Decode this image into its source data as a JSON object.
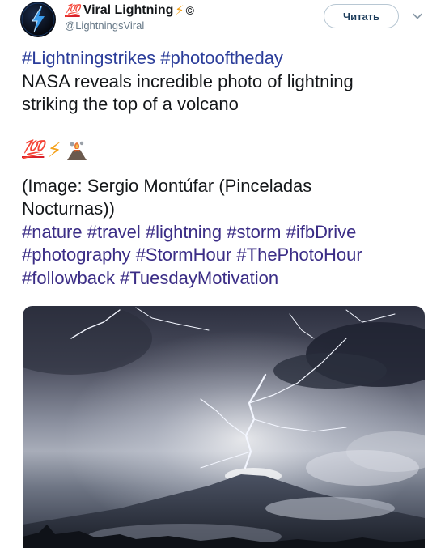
{
  "account": {
    "badge_emoji": "💯",
    "display_name": "Viral Lightning",
    "bolt_emoji": "⚡",
    "copyright": "©",
    "handle": "@LightningsViral",
    "avatar": "lightning-avatar"
  },
  "follow_button": {
    "label": "Читать"
  },
  "more_menu": {
    "icon": "chevron-down-icon"
  },
  "tweet": {
    "hashtags_top": [
      "#Lightningstrikes",
      "#photooftheday"
    ],
    "headline_lines": [
      "NASA reveals incredible photo of lightning",
      "striking the top of a volcano"
    ],
    "emojis": {
      "hundred": "💯",
      "bolt": "⚡",
      "volcano": "🌋"
    },
    "credit_lines": [
      "(Image: Sergio Montúfar (Pinceladas",
      "Nocturnas))"
    ],
    "hashtags_line1": [
      "#nature",
      "#travel",
      "#lightning",
      "#storm",
      "#ifbDrive"
    ],
    "hashtags_line2": [
      "#photography",
      "#StormHour",
      "#ThePhotoHour"
    ],
    "hashtags_line3": [
      "#followback",
      "#TuesdayMotivation"
    ]
  },
  "media": {
    "description_icon": "lightning-volcano-photo"
  },
  "colors": {
    "hashtag": "#2b3d9a",
    "handle": "#657786",
    "button_border": "#b8c7d3"
  }
}
